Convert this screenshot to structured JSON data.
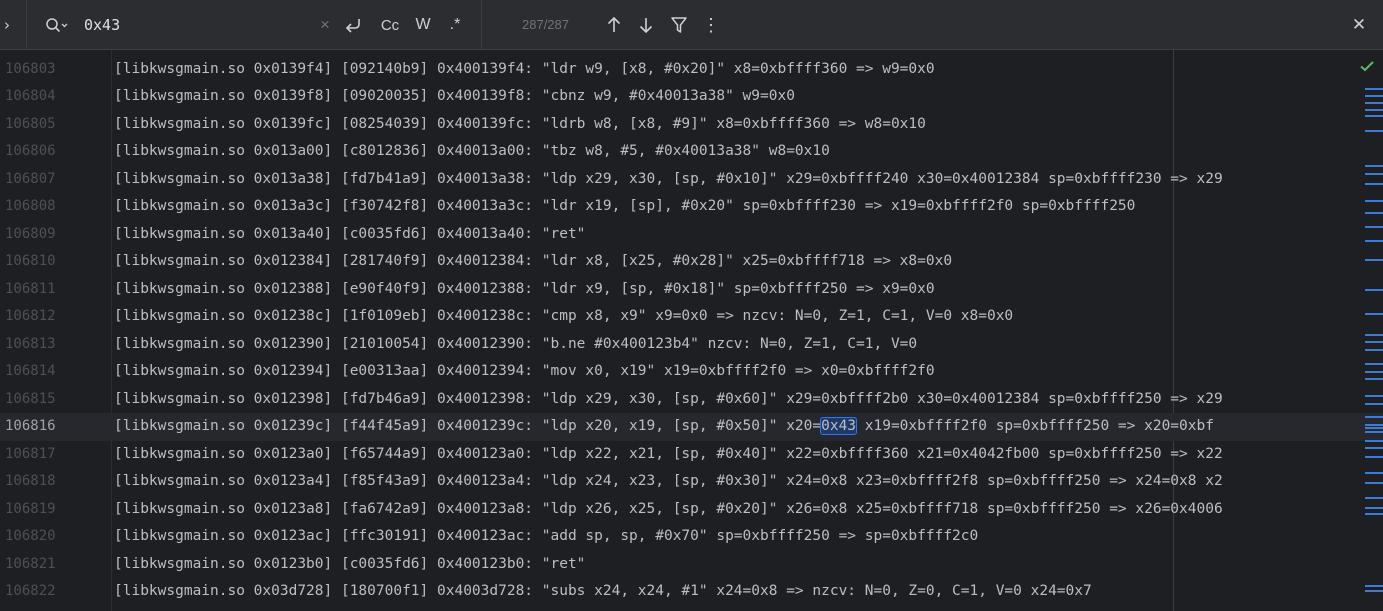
{
  "search": {
    "query": "0x43",
    "clear_glyph": "×",
    "case_label": "Cc",
    "word_label": "W",
    "regex_label": ".*",
    "count": "287/287",
    "close_glyph": "✕",
    "more_glyph": "⋮"
  },
  "editor": {
    "current_line": "106816",
    "highlight": "0x43",
    "lines": [
      {
        "no": "106803",
        "text": "[libkwsgmain.so 0x0139f4] [092140b9] 0x400139f4: \"ldr w9, [x8, #0x20]\" x8=0xbffff360 => w9=0x0"
      },
      {
        "no": "106804",
        "text": "[libkwsgmain.so 0x0139f8] [09020035] 0x400139f8: \"cbnz w9, #0x40013a38\" w9=0x0"
      },
      {
        "no": "106805",
        "text": "[libkwsgmain.so 0x0139fc] [08254039] 0x400139fc: \"ldrb w8, [x8, #9]\" x8=0xbffff360 => w8=0x10"
      },
      {
        "no": "106806",
        "text": "[libkwsgmain.so 0x013a00] [c8012836] 0x40013a00: \"tbz w8, #5, #0x40013a38\" w8=0x10"
      },
      {
        "no": "106807",
        "text": "[libkwsgmain.so 0x013a38] [fd7b41a9] 0x40013a38: \"ldp x29, x30, [sp, #0x10]\" x29=0xbffff240 x30=0x40012384 sp=0xbffff230 => x29"
      },
      {
        "no": "106808",
        "text": "[libkwsgmain.so 0x013a3c] [f30742f8] 0x40013a3c: \"ldr x19, [sp], #0x20\" sp=0xbffff230 => x19=0xbffff2f0 sp=0xbffff250"
      },
      {
        "no": "106809",
        "text": "[libkwsgmain.so 0x013a40] [c0035fd6] 0x40013a40: \"ret\""
      },
      {
        "no": "106810",
        "text": "[libkwsgmain.so 0x012384] [281740f9] 0x40012384: \"ldr x8, [x25, #0x28]\" x25=0xbffff718 => x8=0x0"
      },
      {
        "no": "106811",
        "text": "[libkwsgmain.so 0x012388] [e90f40f9] 0x40012388: \"ldr x9, [sp, #0x18]\" sp=0xbffff250 => x9=0x0"
      },
      {
        "no": "106812",
        "text": "[libkwsgmain.so 0x01238c] [1f0109eb] 0x4001238c: \"cmp x8, x9\" x9=0x0 => nzcv: N=0, Z=1, C=1, V=0 x8=0x0"
      },
      {
        "no": "106813",
        "text": "[libkwsgmain.so 0x012390] [21010054] 0x40012390: \"b.ne #0x400123b4\" nzcv: N=0, Z=1, C=1, V=0"
      },
      {
        "no": "106814",
        "text": "[libkwsgmain.so 0x012394] [e00313aa] 0x40012394: \"mov x0, x19\" x19=0xbffff2f0 => x0=0xbffff2f0"
      },
      {
        "no": "106815",
        "text": "[libkwsgmain.so 0x012398] [fd7b46a9] 0x40012398: \"ldp x29, x30, [sp, #0x60]\" x29=0xbffff2b0 x30=0x40012384 sp=0xbffff250 => x29"
      },
      {
        "no": "106816",
        "pre": "[libkwsgmain.so 0x01239c] [f44f45a9] 0x4001239c: \"ldp x20, x19, [sp, #0x50]\" x20=",
        "match": "0x43",
        "post": " x19=0xbffff2f0 sp=0xbffff250 => x20=0xbf"
      },
      {
        "no": "106817",
        "text": "[libkwsgmain.so 0x0123a0] [f65744a9] 0x400123a0: \"ldp x22, x21, [sp, #0x40]\" x22=0xbffff360 x21=0x4042fb00 sp=0xbffff250 => x22"
      },
      {
        "no": "106818",
        "text": "[libkwsgmain.so 0x0123a4] [f85f43a9] 0x400123a4: \"ldp x24, x23, [sp, #0x30]\" x24=0x8 x23=0xbffff2f8 sp=0xbffff250 => x24=0x8 x2"
      },
      {
        "no": "106819",
        "text": "[libkwsgmain.so 0x0123a8] [fa6742a9] 0x400123a8: \"ldp x26, x25, [sp, #0x20]\" x26=0x8 x25=0xbffff718 sp=0xbffff250 => x26=0x4006"
      },
      {
        "no": "106820",
        "text": "[libkwsgmain.so 0x0123ac] [ffc30191] 0x400123ac: \"add sp, sp, #0x70\" sp=0xbffff250 => sp=0xbffff2c0"
      },
      {
        "no": "106821",
        "text": "[libkwsgmain.so 0x0123b0] [c0035fd6] 0x400123b0: \"ret\""
      },
      {
        "no": "106822",
        "text": "[libkwsgmain.so 0x03d728] [180700f1] 0x4003d728: \"subs x24, x24, #1\" x24=0x8 => nzcv: N=0, Z=0, C=1, V=0 x24=0x7"
      }
    ]
  },
  "colors": {
    "background": "#1e1f22",
    "toolbar": "#2b2d30",
    "accent": "#3574f0",
    "marker": "#3d7bd4",
    "ok": "#5fb865"
  },
  "icons": [
    "search-icon",
    "expand-icon",
    "clear-icon",
    "newline-icon",
    "arrow-up-icon",
    "arrow-down-icon",
    "filter-icon",
    "more-icon",
    "close-icon",
    "check-icon"
  ]
}
